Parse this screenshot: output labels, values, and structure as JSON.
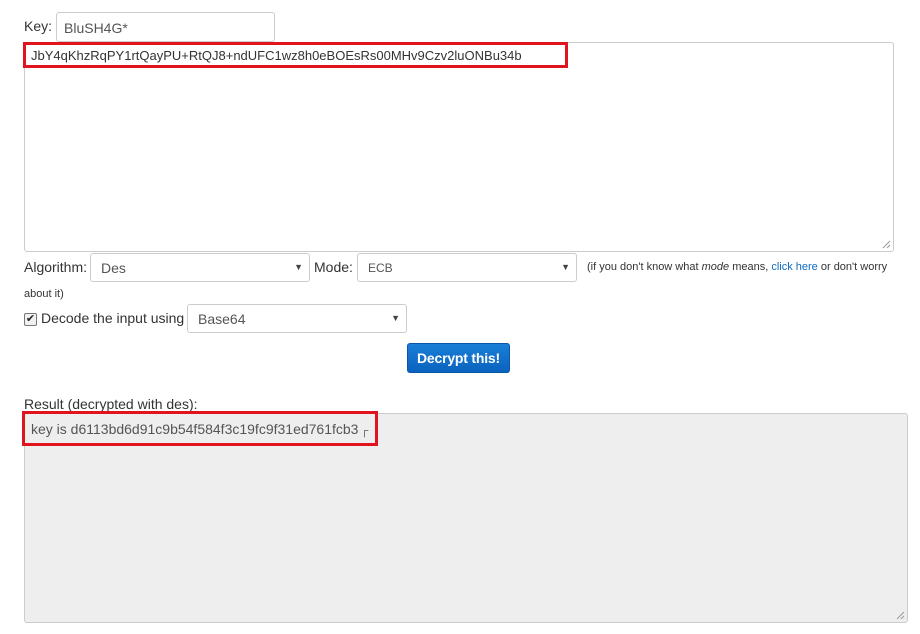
{
  "key": {
    "label": "Key:",
    "value": "BluSH4G*"
  },
  "input": {
    "text": "JbY4qKhzRqPY1rtQayPU+RtQJ8+ndUFC1wz8h0eBOEsRs00MHv9Czv2luONBu34b"
  },
  "algorithm": {
    "label": "Algorithm:",
    "selected": "Des"
  },
  "mode": {
    "label": "Mode:",
    "selected": "ECB"
  },
  "help": {
    "prefix": "(if you don't know what ",
    "mode_word": "mode",
    "middle": " means, ",
    "link": "click here",
    "suffix": " or don't worry",
    "line2": "about it)"
  },
  "decode": {
    "label": "Decode the input using",
    "selected": "Base64",
    "checked": true
  },
  "submit": {
    "label": "Decrypt this!"
  },
  "result": {
    "label": "Result (decrypted with des):",
    "text": "key is d6113bd6d91c9b54f584f3c19fc9f31ed761fcb3",
    "trailing": "┌"
  },
  "colors": {
    "highlight": "#e0141e",
    "button": "#0a63bf",
    "link": "#0d6bbf",
    "result_bg": "#eeeeee"
  }
}
